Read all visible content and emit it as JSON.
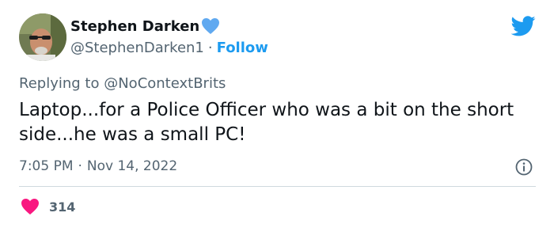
{
  "author": {
    "display_name": "Stephen Darken",
    "handle": "@StephenDarken1",
    "separator": "·",
    "follow_label": "Follow"
  },
  "reply": {
    "prefix": "Replying to",
    "mention": "@NoContextBrits"
  },
  "tweet": {
    "text": "Laptop...for a Police Officer who was a bit on the short side...he was a small PC!"
  },
  "meta": {
    "time": "7:05 PM",
    "separator": "·",
    "date": "Nov 14, 2022"
  },
  "engagement": {
    "likes": "314"
  },
  "colors": {
    "brand_blue": "#1d9bf0",
    "like_pink": "#f91880",
    "muted_text": "#536471",
    "badge_blue": "#60a9f0"
  },
  "icons": {
    "badge": "heart-badge-icon",
    "brand": "twitter-bird-icon",
    "info": "info-icon",
    "like": "heart-icon"
  }
}
